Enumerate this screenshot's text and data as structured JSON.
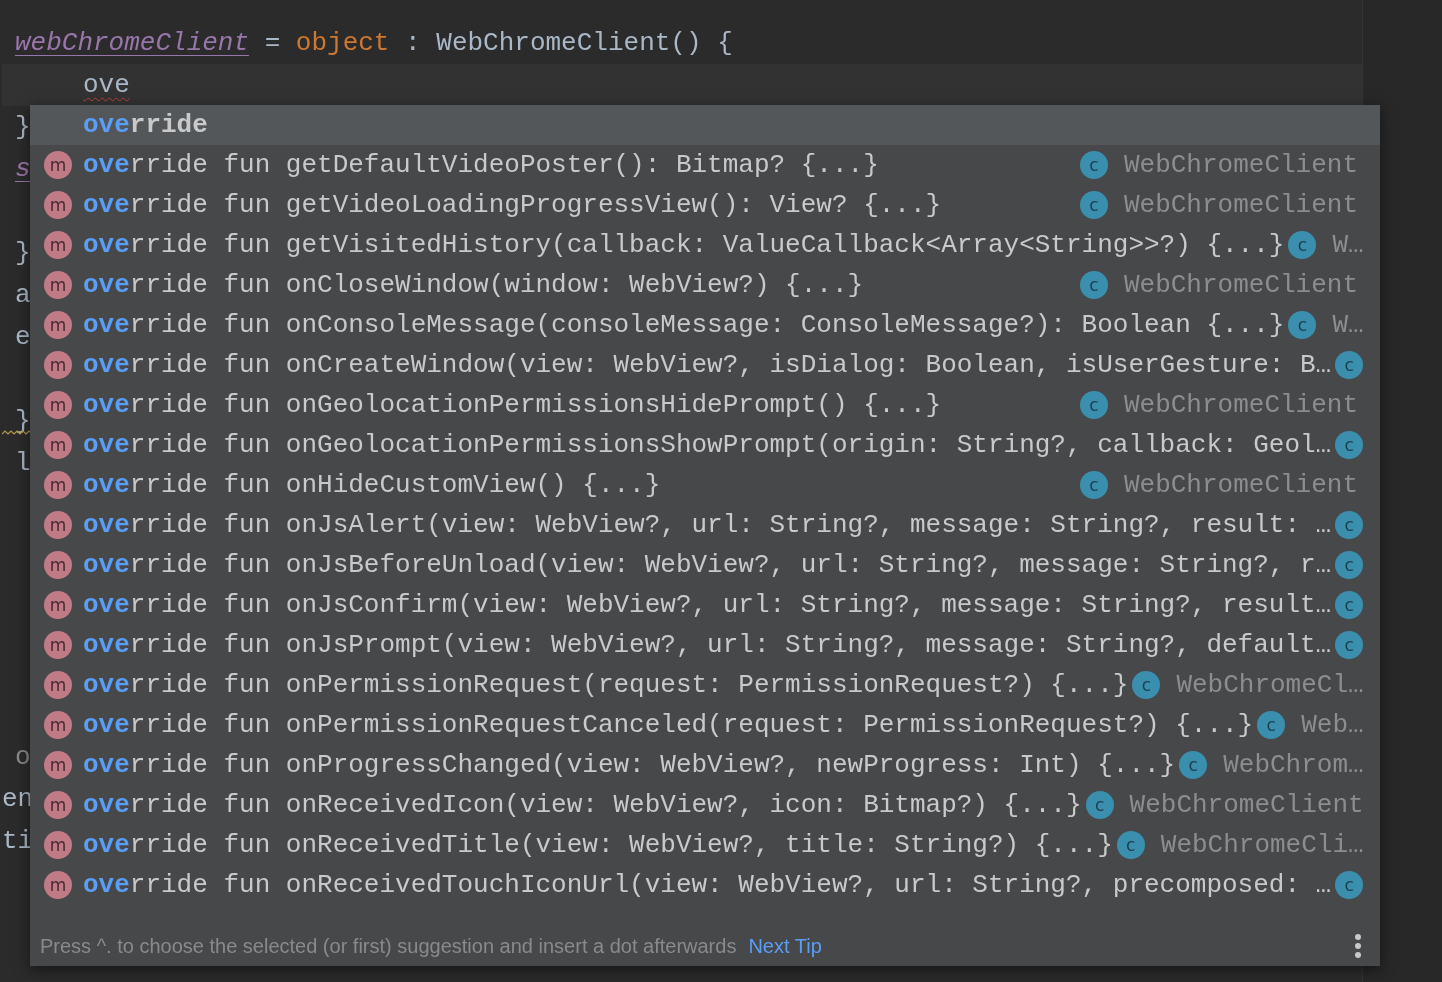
{
  "editor": {
    "lines": [
      {
        "kind": "blank"
      },
      {
        "kind": "top",
        "tokens": [
          {
            "text": "webChromeClient",
            "kind": "property"
          },
          {
            "text": " = ",
            "kind": "plain"
          },
          {
            "text": "object",
            "kind": "keyword"
          },
          {
            "text": " : WebChromeClient() {",
            "kind": "plain"
          }
        ]
      },
      {
        "kind": "body",
        "current": true,
        "tokens": [
          {
            "text": "ove",
            "kind": "plain",
            "error": true
          }
        ]
      },
      {
        "kind": "top",
        "tokens": [
          {
            "text": "}",
            "kind": "plain"
          }
        ]
      },
      {
        "kind": "top",
        "tokens": [
          {
            "text": "s",
            "kind": "property"
          }
        ]
      },
      {
        "kind": "blank"
      },
      {
        "kind": "top",
        "tokens": [
          {
            "text": "}",
            "kind": "plain"
          }
        ]
      },
      {
        "kind": "top",
        "tokens": [
          {
            "text": "a",
            "kind": "plain"
          }
        ]
      },
      {
        "kind": "top",
        "tokens": [
          {
            "text": "e",
            "kind": "plain"
          }
        ]
      },
      {
        "kind": "blank"
      },
      {
        "kind": "top",
        "warning": true,
        "tokens": [
          {
            "text": "}",
            "kind": "plain"
          }
        ]
      },
      {
        "kind": "top",
        "tokens": [
          {
            "text": "l",
            "kind": "plain"
          }
        ]
      },
      {
        "kind": "blank"
      },
      {
        "kind": "blank"
      },
      {
        "kind": "blank"
      },
      {
        "kind": "blank"
      },
      {
        "kind": "blank"
      },
      {
        "kind": "blank"
      },
      {
        "kind": "top",
        "tokens": [
          {
            "text": "o",
            "kind": "dim"
          }
        ]
      },
      {
        "kind": "outer",
        "tokens": [
          {
            "text": "en",
            "kind": "plain"
          }
        ]
      },
      {
        "kind": "outer",
        "tokens": [
          {
            "text": "ti",
            "kind": "plain"
          }
        ]
      }
    ]
  },
  "completion": {
    "items": [
      {
        "kind": "keyword",
        "selected": true,
        "match": "ove",
        "text": "rride"
      },
      {
        "kind": "method",
        "selected": false,
        "icon": "m",
        "match": "ove",
        "text": "rride fun getDefaultVideoPoster(): Bitmap? {...}",
        "type_icon": "c",
        "type": "WebChromeClient"
      },
      {
        "kind": "method",
        "selected": false,
        "icon": "m",
        "match": "ove",
        "text": "rride fun getVideoLoadingProgressView(): View? {...}",
        "type_icon": "c",
        "type": "WebChromeClient"
      },
      {
        "kind": "method",
        "selected": false,
        "icon": "m",
        "match": "ove",
        "text": "rride fun getVisitedHistory(callback: ValueCallback<Array<String>>?) {...}",
        "type_icon": "c",
        "type": "W…"
      },
      {
        "kind": "method",
        "selected": false,
        "icon": "m",
        "match": "ove",
        "text": "rride fun onCloseWindow(window: WebView?) {...}",
        "type_icon": "c",
        "type": "WebChromeClient"
      },
      {
        "kind": "method",
        "selected": false,
        "icon": "m",
        "match": "ove",
        "text": "rride fun onConsoleMessage(consoleMessage: ConsoleMessage?): Boolean {...}",
        "type_icon": "c",
        "type": "W…"
      },
      {
        "kind": "method",
        "selected": false,
        "icon": "m",
        "match": "ove",
        "text": "rride fun onCreateWindow(view: WebView?, isDialog: Boolean, isUserGesture: B…",
        "type_icon": "c"
      },
      {
        "kind": "method",
        "selected": false,
        "icon": "m",
        "match": "ove",
        "text": "rride fun onGeolocationPermissionsHidePrompt() {...}",
        "type_icon": "c",
        "type": "WebChromeClient"
      },
      {
        "kind": "method",
        "selected": false,
        "icon": "m",
        "match": "ove",
        "text": "rride fun onGeolocationPermissionsShowPrompt(origin: String?, callback: Geol…",
        "type_icon": "c"
      },
      {
        "kind": "method",
        "selected": false,
        "icon": "m",
        "match": "ove",
        "text": "rride fun onHideCustomView() {...}",
        "type_icon": "c",
        "type": "WebChromeClient"
      },
      {
        "kind": "method",
        "selected": false,
        "icon": "m",
        "match": "ove",
        "text": "rride fun onJsAlert(view: WebView?, url: String?, message: String?, result: …",
        "type_icon": "c"
      },
      {
        "kind": "method",
        "selected": false,
        "icon": "m",
        "match": "ove",
        "text": "rride fun onJsBeforeUnload(view: WebView?, url: String?, message: String?, r…",
        "type_icon": "c"
      },
      {
        "kind": "method",
        "selected": false,
        "icon": "m",
        "match": "ove",
        "text": "rride fun onJsConfirm(view: WebView?, url: String?, message: String?, result…",
        "type_icon": "c"
      },
      {
        "kind": "method",
        "selected": false,
        "icon": "m",
        "match": "ove",
        "text": "rride fun onJsPrompt(view: WebView?, url: String?, message: String?, default…",
        "type_icon": "c"
      },
      {
        "kind": "method",
        "selected": false,
        "icon": "m",
        "match": "ove",
        "text": "rride fun onPermissionRequest(request: PermissionRequest?) {...}",
        "type_icon": "c",
        "type": "WebChromeCl…"
      },
      {
        "kind": "method",
        "selected": false,
        "icon": "m",
        "match": "ove",
        "text": "rride fun onPermissionRequestCanceled(request: PermissionRequest?) {...}",
        "type_icon": "c",
        "type": "Web…"
      },
      {
        "kind": "method",
        "selected": false,
        "icon": "m",
        "match": "ove",
        "text": "rride fun onProgressChanged(view: WebView?, newProgress: Int) {...}",
        "type_icon": "c",
        "type": "WebChrom…"
      },
      {
        "kind": "method",
        "selected": false,
        "icon": "m",
        "match": "ove",
        "text": "rride fun onReceivedIcon(view: WebView?, icon: Bitmap?) {...}",
        "type_icon": "c",
        "type": "WebChromeClient"
      },
      {
        "kind": "method",
        "selected": false,
        "icon": "m",
        "match": "ove",
        "text": "rride fun onReceivedTitle(view: WebView?, title: String?) {...}",
        "type_icon": "c",
        "type": "WebChromeCli…"
      },
      {
        "kind": "method",
        "selected": false,
        "icon": "m",
        "match": "ove",
        "text": "rride fun onReceivedTouchIconUrl(view: WebView?, url: String?, precomposed: …",
        "type_icon": "c"
      }
    ],
    "footer": {
      "hint": "Press ^. to choose the selected (or first) suggestion and insert a dot afterwards",
      "link": "Next Tip"
    }
  }
}
